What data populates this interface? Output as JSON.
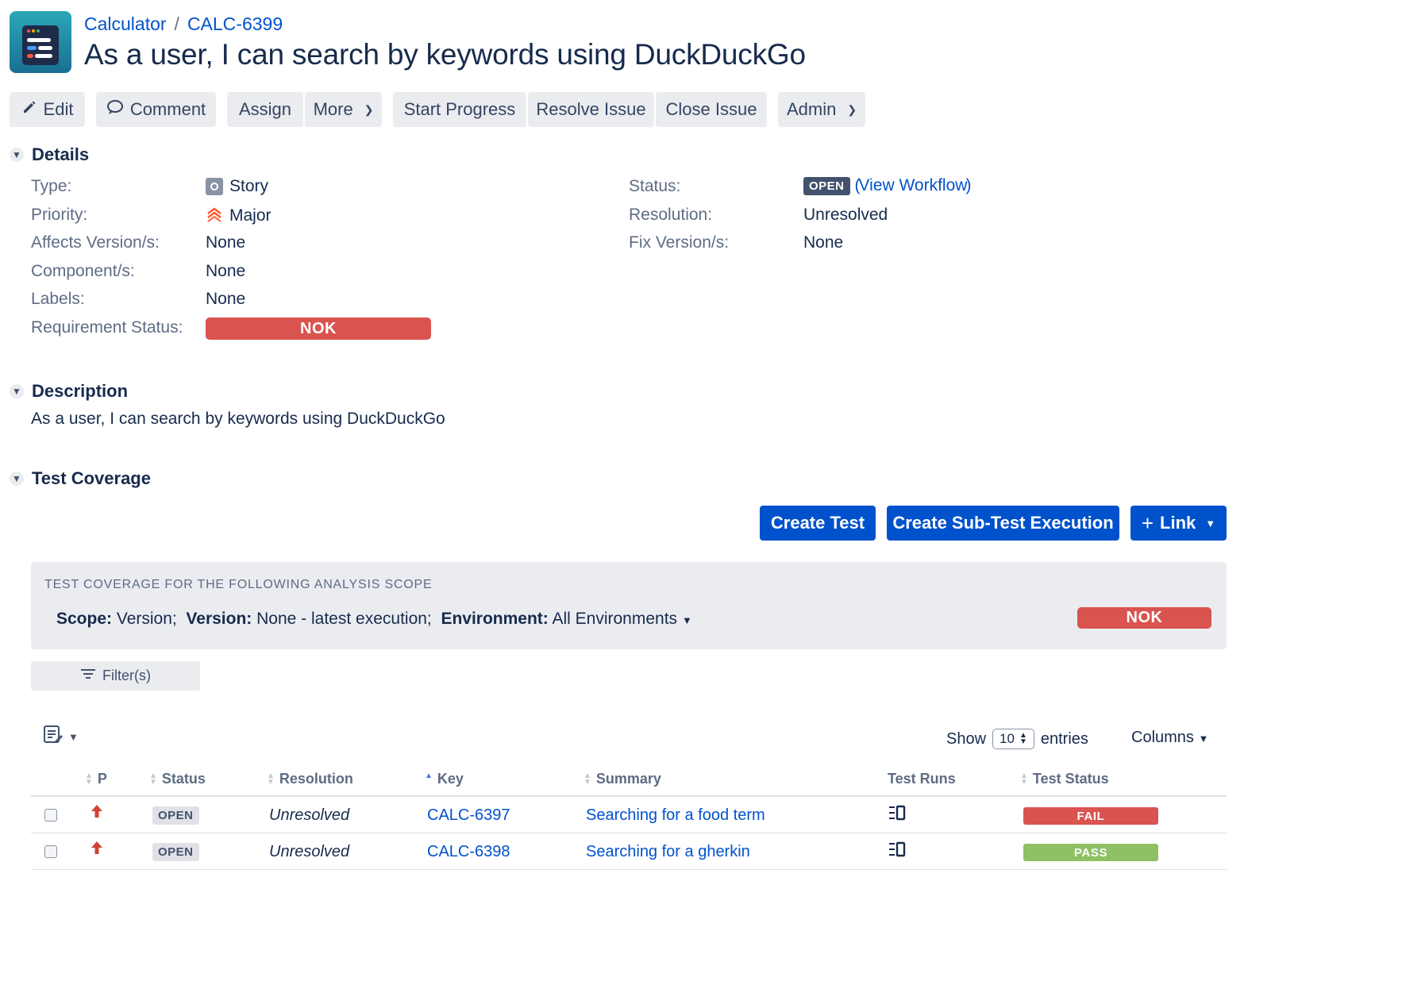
{
  "header": {
    "project": "Calculator",
    "separator": "/",
    "issue_key": "CALC-6399",
    "title": "As a user, I can search by keywords using DuckDuckGo"
  },
  "toolbar": {
    "edit": "Edit",
    "comment": "Comment",
    "assign": "Assign",
    "more": "More",
    "start_progress": "Start Progress",
    "resolve_issue": "Resolve Issue",
    "close_issue": "Close Issue",
    "admin": "Admin"
  },
  "details": {
    "heading": "Details",
    "type_label": "Type:",
    "type_value": "Story",
    "priority_label": "Priority:",
    "priority_value": "Major",
    "affects_label": "Affects Version/s:",
    "affects_value": "None",
    "component_label": "Component/s:",
    "component_value": "None",
    "labels_label": "Labels:",
    "labels_value": "None",
    "req_status_label": "Requirement Status:",
    "req_status_value": "NOK",
    "status_label": "Status:",
    "status_value": "OPEN",
    "view_workflow": "View Workflow",
    "paren_open": "(",
    "paren_close": ")",
    "resolution_label": "Resolution:",
    "resolution_value": "Unresolved",
    "fix_label": "Fix Version/s:",
    "fix_value": "None"
  },
  "description": {
    "heading": "Description",
    "text": "As a user, I can search by keywords using DuckDuckGo"
  },
  "coverage": {
    "heading": "Test Coverage",
    "create_test": "Create Test",
    "create_sub_exec": "Create Sub-Test Execution",
    "link": "Link",
    "scope_caption": "TEST COVERAGE FOR THE FOLLOWING ANALYSIS SCOPE",
    "scope_label": "Scope:",
    "scope_value": "Version;",
    "version_label": "Version:",
    "version_value": "None - latest execution;",
    "env_label": "Environment:",
    "env_value": "All Environments",
    "scope_status": "NOK",
    "filters": "Filter(s)"
  },
  "table": {
    "show": "Show",
    "page_size": "10",
    "entries": "entries",
    "columns": "Columns",
    "headers": {
      "p": "P",
      "status": "Status",
      "resolution": "Resolution",
      "key": "Key",
      "summary": "Summary",
      "test_runs": "Test Runs",
      "test_status": "Test Status"
    },
    "rows": [
      {
        "status": "OPEN",
        "resolution": "Unresolved",
        "key": "CALC-6397",
        "summary": "Searching for a food term",
        "test_status": "FAIL",
        "test_status_color": "#d9534f"
      },
      {
        "status": "OPEN",
        "resolution": "Unresolved",
        "key": "CALC-6398",
        "summary": "Searching for a gherkin",
        "test_status": "PASS",
        "test_status_color": "#8dc163"
      }
    ]
  },
  "colors": {
    "primary": "#0052cc",
    "nok": "#d9534f",
    "pass": "#8dc163"
  }
}
